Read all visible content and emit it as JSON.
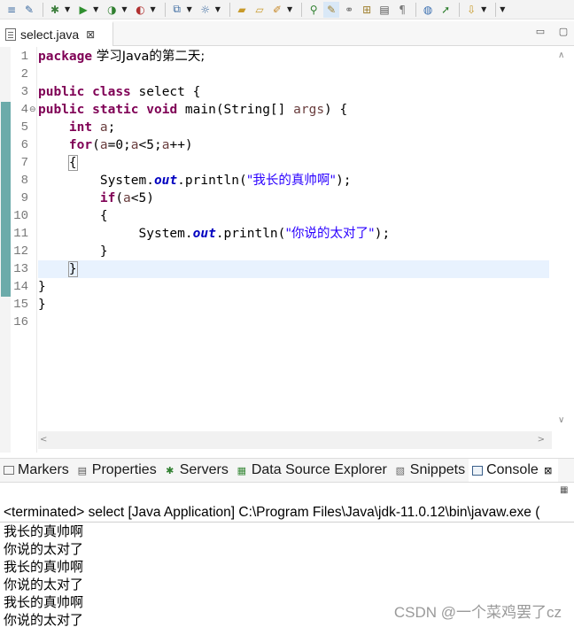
{
  "toolbar": {
    "icons": [
      "toggle-icon",
      "task-icon",
      "debug-icon",
      "run-icon",
      "coverage-icon",
      "external-tools-icon",
      "new-server-icon",
      "new-web-icon",
      "open-folder-icon",
      "open-file-icon",
      "search-tool-icon",
      "annotation-icon",
      "highlight-icon",
      "link-icon",
      "outline-icon",
      "page-icon",
      "paragraph-icon",
      "globe-icon",
      "forward-icon",
      "down-arrow-icon"
    ]
  },
  "editor_tab": {
    "file_name": "select.java",
    "close_glyph": "⊠"
  },
  "editor": {
    "line_numbers": [
      "1",
      "2",
      "3",
      "4",
      "5",
      "6",
      "7",
      "8",
      "9",
      "10",
      "11",
      "12",
      "13",
      "14",
      "15",
      "16"
    ],
    "fold_marker": "⊖",
    "current_line_number": 13,
    "code": {
      "l1_kw": "package",
      "l1_rest": " 学习Java的第二天;",
      "l3_kw1": "public",
      "l3_kw2": "class",
      "l3_rest": " select {",
      "l4_kw1": "public",
      "l4_kw2": "static",
      "l4_kw3": "void",
      "l4_mid": " main(String[] ",
      "l4_var": "args",
      "l4_end": ") {",
      "l5_kw": "int",
      "l5_var": "a",
      "l5_end": ";",
      "l6_kw": "for",
      "l6_p1": "(",
      "l6_v1": "a",
      "l6_p2": "=0;",
      "l6_v2": "a",
      "l6_p3": "<5;",
      "l6_v3": "a",
      "l6_p4": "++)",
      "l7_brace": "{",
      "l8_obj": "System.",
      "l8_fld": "out",
      "l8_call": ".println(",
      "l8_str": "\"我长的真帅啊\"",
      "l8_end": ");",
      "l9_kw": "if",
      "l9_p1": "(",
      "l9_var": "a",
      "l9_p2": "<5)",
      "l10_brace": "{",
      "l11_obj": "System.",
      "l11_fld": "out",
      "l11_call": ".println(",
      "l11_str": "\"你说的太对了\"",
      "l11_end": ");",
      "l12_brace": "}",
      "l13_brace": "}",
      "l14_brace": "}",
      "l15_brace": "}"
    }
  },
  "views": {
    "tabs": [
      {
        "label": "Markers",
        "icon": "markers-icon"
      },
      {
        "label": "Properties",
        "icon": "properties-icon"
      },
      {
        "label": "Servers",
        "icon": "servers-icon"
      },
      {
        "label": "Data Source Explorer",
        "icon": "data-source-icon"
      },
      {
        "label": "Snippets",
        "icon": "snippets-icon"
      },
      {
        "label": "Console",
        "icon": "console-icon",
        "close": "⊠"
      }
    ],
    "active": "Console"
  },
  "console": {
    "header": "<terminated> select [Java Application] C:\\Program Files\\Java\\jdk-11.0.12\\bin\\javaw.exe  (",
    "output": [
      "我长的真帅啊",
      "你说的太对了",
      "我长的真帅啊",
      "你说的太对了",
      "我长的真帅啊",
      "你说的太对了"
    ]
  },
  "watermark": "CSDN @一个菜鸡罢了cz",
  "colors": {
    "keyword": "#7f0055",
    "string": "#2a00ff",
    "field": "#0000c0",
    "variable": "#6a3e3e",
    "current_line": "#e8f2fe",
    "change_bar": "#6cabaa"
  }
}
